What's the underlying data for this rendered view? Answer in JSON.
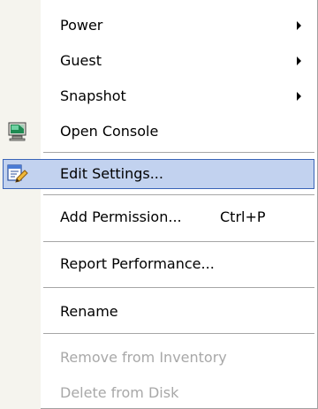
{
  "menu": {
    "items": [
      {
        "label": "Power",
        "has_submenu": true,
        "enabled": true
      },
      {
        "label": "Guest",
        "has_submenu": true,
        "enabled": true
      },
      {
        "label": "Snapshot",
        "has_submenu": true,
        "enabled": true
      },
      {
        "label": "Open Console",
        "icon": "console-icon",
        "enabled": true
      },
      {
        "label": "Edit Settings...",
        "icon": "edit-settings-icon",
        "enabled": true,
        "highlighted": true
      },
      {
        "label": "Add Permission...",
        "shortcut": "Ctrl+P",
        "enabled": true
      },
      {
        "label": "Report Performance...",
        "enabled": true
      },
      {
        "label": "Rename",
        "enabled": true
      },
      {
        "label": "Remove from Inventory",
        "enabled": false
      },
      {
        "label": "Delete from Disk",
        "enabled": false
      }
    ]
  },
  "colors": {
    "highlight_fill": "#c2d2ef",
    "highlight_border": "#3a64b8",
    "disabled_text": "#a8a8a8",
    "gutter": "#f5f4ee"
  }
}
